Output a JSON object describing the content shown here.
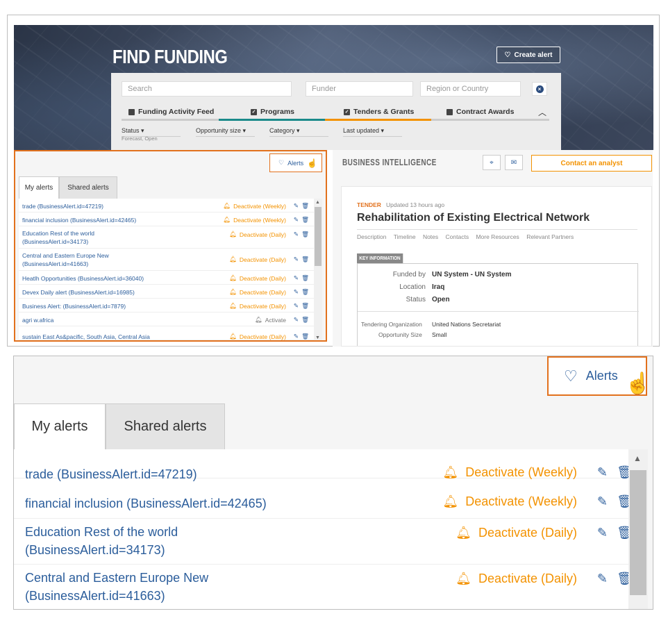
{
  "hero": {
    "title": "FIND FUNDING",
    "create_alert": "Create alert"
  },
  "search": {
    "search_placeholder": "Search",
    "funder_placeholder": "Funder",
    "region_placeholder": "Region or Country"
  },
  "filter_tabs": [
    {
      "label": "Funding Activity Feed",
      "checked": false
    },
    {
      "label": "Programs",
      "checked": true
    },
    {
      "label": "Tenders & Grants",
      "checked": true
    },
    {
      "label": "Contract Awards",
      "checked": false
    }
  ],
  "filters": {
    "status": "Status",
    "status_value": "Forecast, Open",
    "opportunity_size": "Opportunity size",
    "category": "Category",
    "last_updated": "Last updated"
  },
  "alerts_panel": {
    "alerts_button": "Alerts",
    "tabs": [
      "My alerts",
      "Shared alerts"
    ],
    "items": [
      {
        "name": "trade (BusinessAlert.id=47219)",
        "action": "Deactivate (Weekly)"
      },
      {
        "name": "financial inclusion (BusinessAlert.id=42465)",
        "action": "Deactivate (Weekly)"
      },
      {
        "name": "Education Rest of the world (BusinessAlert.id=34173)",
        "action": "Deactivate (Daily)"
      },
      {
        "name": "Central and Eastern Europe New (BusinessAlert.id=41663)",
        "action": "Deactivate (Daily)"
      },
      {
        "name": "Heatlh Opportunities (BusinessAlert.id=36040)",
        "action": "Deactivate (Daily)"
      },
      {
        "name": "Devex Daily alert (BusinessAlert.id=16985)",
        "action": "Deactivate (Daily)"
      },
      {
        "name": "Business Alert: (BusinessAlert.id=7879)",
        "action": "Deactivate (Daily)"
      },
      {
        "name": "agri w.africa",
        "action": "Activate"
      },
      {
        "name": "sustain East As&pacific, South Asia, Central Asia",
        "action": "Deactivate (Daily)"
      }
    ]
  },
  "bi_panel": {
    "title": "BUSINESS INTELLIGENCE",
    "contact": "Contact an analyst",
    "tag": "TENDER",
    "updated": "Updated 13 hours ago",
    "headline": "Rehabilitation of Existing Electrical Network",
    "subnav": [
      "Description",
      "Timeline",
      "Notes",
      "Contacts",
      "More Resources",
      "Relevant Partners"
    ],
    "key_info_label": "KEY INFORMATION",
    "funded_by_label": "Funded by",
    "funded_by": "UN System - UN System",
    "location_label": "Location",
    "location": "Iraq",
    "status_label": "Status",
    "status": "Open",
    "tendering_org_label": "Tendering Organization",
    "tendering_org": "United Nations Secretariat",
    "opp_size_label": "Opportunity Size",
    "opp_size": "Small"
  },
  "zoom": {
    "alerts_button": "Alerts",
    "tabs": [
      "My alerts",
      "Shared alerts"
    ],
    "rows": [
      {
        "line1": "trade (BusinessAlert.id=47219)",
        "line2": "",
        "action": "Deactivate (Weekly)"
      },
      {
        "line1": "financial inclusion (BusinessAlert.id=42465)",
        "line2": "",
        "action": "Deactivate (Weekly)"
      },
      {
        "line1": "Education Rest of the world",
        "line2": "(BusinessAlert.id=34173)",
        "action": "Deactivate (Daily)"
      },
      {
        "line1": "Central and Eastern Europe New",
        "line2": "(BusinessAlert.id=41663)",
        "action": "Deactivate (Daily)"
      }
    ]
  },
  "colors": {
    "accent": "#e2711d",
    "orange": "#f39200",
    "link": "#2b5d9b",
    "teal": "#1a8a8a"
  }
}
